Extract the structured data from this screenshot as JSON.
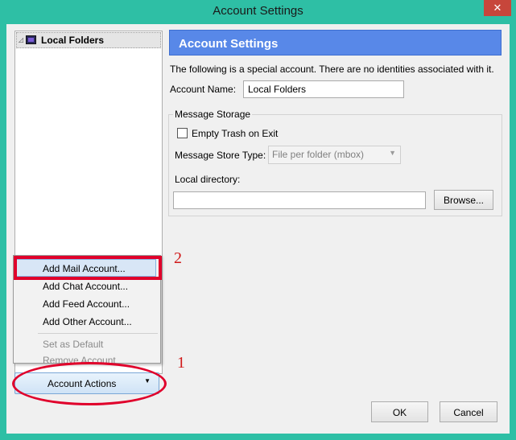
{
  "window": {
    "title": "Account Settings",
    "close_glyph": "✕"
  },
  "tree": {
    "items": [
      {
        "label": "Local Folders",
        "icon": "local-folders-icon",
        "twisty": "◿"
      }
    ]
  },
  "menu": {
    "items": [
      {
        "label": "Add Mail Account...",
        "enabled": true,
        "highlighted": true
      },
      {
        "label": "Add Chat Account...",
        "enabled": true
      },
      {
        "label": "Add Feed Account...",
        "enabled": true
      },
      {
        "label": "Add Other Account...",
        "enabled": true
      },
      {
        "label": "Set as Default",
        "enabled": false
      },
      {
        "label": "Remove Account",
        "enabled": false
      }
    ]
  },
  "account_actions": {
    "label": "Account Actions",
    "arrow": "▼"
  },
  "annotations": {
    "step1": "1",
    "step2": "2",
    "color": "#e0002b"
  },
  "settings": {
    "header": "Account Settings",
    "description": "The following is a special account. There are no identities associated with it.",
    "account_name_label": "Account Name:",
    "account_name_value": "Local Folders",
    "message_storage_legend": "Message Storage",
    "empty_trash_label": "Empty Trash on Exit",
    "empty_trash_checked": false,
    "store_type_label": "Message Store Type:",
    "store_type_value": "File per folder (mbox)",
    "local_directory_label": "Local directory:",
    "local_directory_value": "",
    "browse_label": "Browse..."
  },
  "footer": {
    "ok_label": "OK",
    "cancel_label": "Cancel"
  },
  "colors": {
    "window_chrome": "#2ebfa5",
    "header_bar": "#5888e8",
    "close_button": "#c7463b",
    "annotation_red": "#e0002b"
  }
}
